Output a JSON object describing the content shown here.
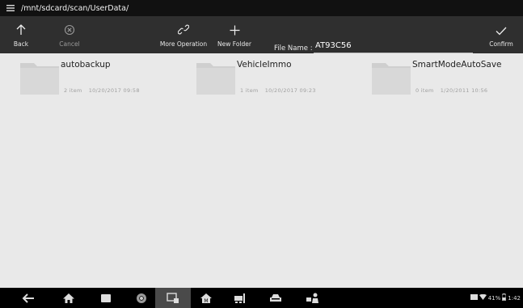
{
  "path_bar": {
    "menu_icon": "hamburger-menu-icon",
    "path": "/mnt/sdcard/scan/UserData/"
  },
  "toolbar": {
    "back_label": "Back",
    "cancel_label": "Cancel",
    "more_operation_label": "More Operation",
    "new_folder_label": "New Folder",
    "file_name_label": "File Name :",
    "file_name_value": "AT93C56",
    "confirm_label": "Confirm"
  },
  "files": [
    {
      "name": "autobackup",
      "count": "2 item",
      "date": "10/20/2017 09:58"
    },
    {
      "name": "VehicleImmo",
      "count": "1 item",
      "date": "10/20/2017 09:23"
    },
    {
      "name": "SmartModeAutoSave",
      "count": "0 item",
      "date": "1/20/2011 10:56"
    }
  ],
  "navbar": {
    "items": [
      "back-arrow-icon",
      "home-icon",
      "recent-apps-icon",
      "chrome-icon",
      "screenshot-icon",
      "maxisys-home-icon",
      "vehicle-lift-icon",
      "car-icon",
      "technician-icon"
    ],
    "active_index": 4
  },
  "status": {
    "battery_percent": "41%",
    "time": "1:42"
  },
  "colors": {
    "toolbar_bg": "#2f2f2f",
    "pathbar_bg": "#111111",
    "content_bg": "#e9e9e9",
    "folder": "#cfcfcf"
  }
}
